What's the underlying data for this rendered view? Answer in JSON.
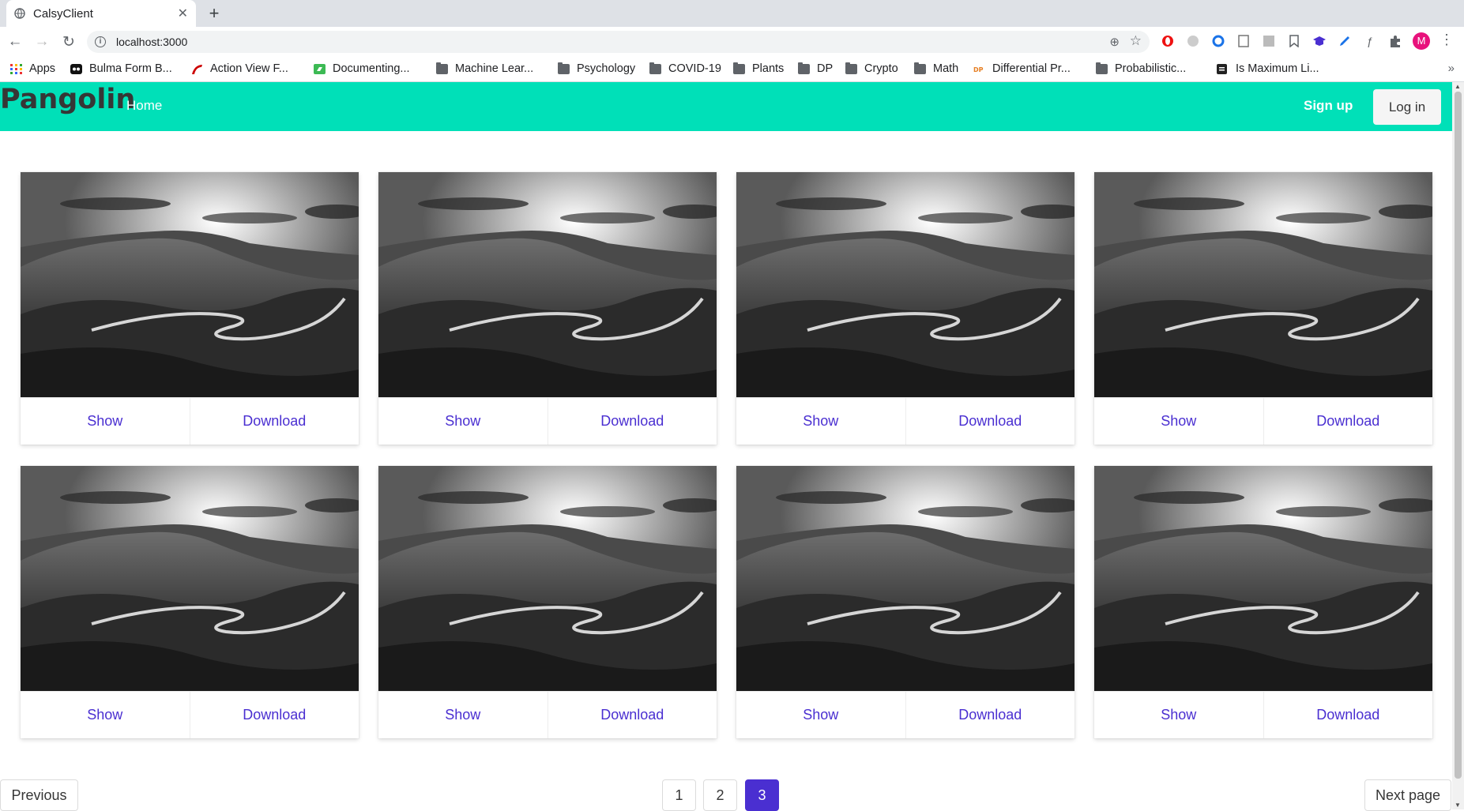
{
  "browser": {
    "tab_title": "CalsyClient",
    "close_tab": "✕",
    "new_tab": "+",
    "url": "localhost:3000",
    "back": "←",
    "forward": "→",
    "reload": "↻"
  },
  "bookmarks": [
    {
      "label": "Apps",
      "icon": "apps-grid-icon"
    },
    {
      "label": "Bulma Form B...",
      "icon": "bulma-icon"
    },
    {
      "label": "Action View F...",
      "icon": "rails-icon"
    },
    {
      "label": "Documenting...",
      "icon": "doc-site-icon"
    },
    {
      "label": "Machine Lear...",
      "icon": "folder-icon"
    },
    {
      "label": "Psychology",
      "icon": "folder-icon"
    },
    {
      "label": "COVID-19",
      "icon": "folder-icon"
    },
    {
      "label": "Plants",
      "icon": "folder-icon"
    },
    {
      "label": "DP",
      "icon": "folder-icon"
    },
    {
      "label": "Crypto",
      "icon": "folder-icon"
    },
    {
      "label": "Math",
      "icon": "folder-icon"
    },
    {
      "label": "Differential Pr...",
      "icon": "dp-icon"
    },
    {
      "label": "Probabilistic...",
      "icon": "folder-icon"
    },
    {
      "label": "Is Maximum Li...",
      "icon": "page-icon"
    }
  ],
  "bookmarks_more": "»",
  "profile_initial": "M",
  "navbar": {
    "brand": "Pangolin",
    "home": "Home",
    "signup": "Sign up",
    "login": "Log in",
    "color": "#00e0b8"
  },
  "cards": [
    {
      "show": "Show",
      "download": "Download"
    },
    {
      "show": "Show",
      "download": "Download"
    },
    {
      "show": "Show",
      "download": "Download"
    },
    {
      "show": "Show",
      "download": "Download"
    },
    {
      "show": "Show",
      "download": "Download"
    },
    {
      "show": "Show",
      "download": "Download"
    },
    {
      "show": "Show",
      "download": "Download"
    },
    {
      "show": "Show",
      "download": "Download"
    }
  ],
  "pagination": {
    "previous": "Previous",
    "next": "Next page",
    "pages": [
      "1",
      "2",
      "3"
    ],
    "current": "3",
    "accent": "#4a2fd1"
  }
}
